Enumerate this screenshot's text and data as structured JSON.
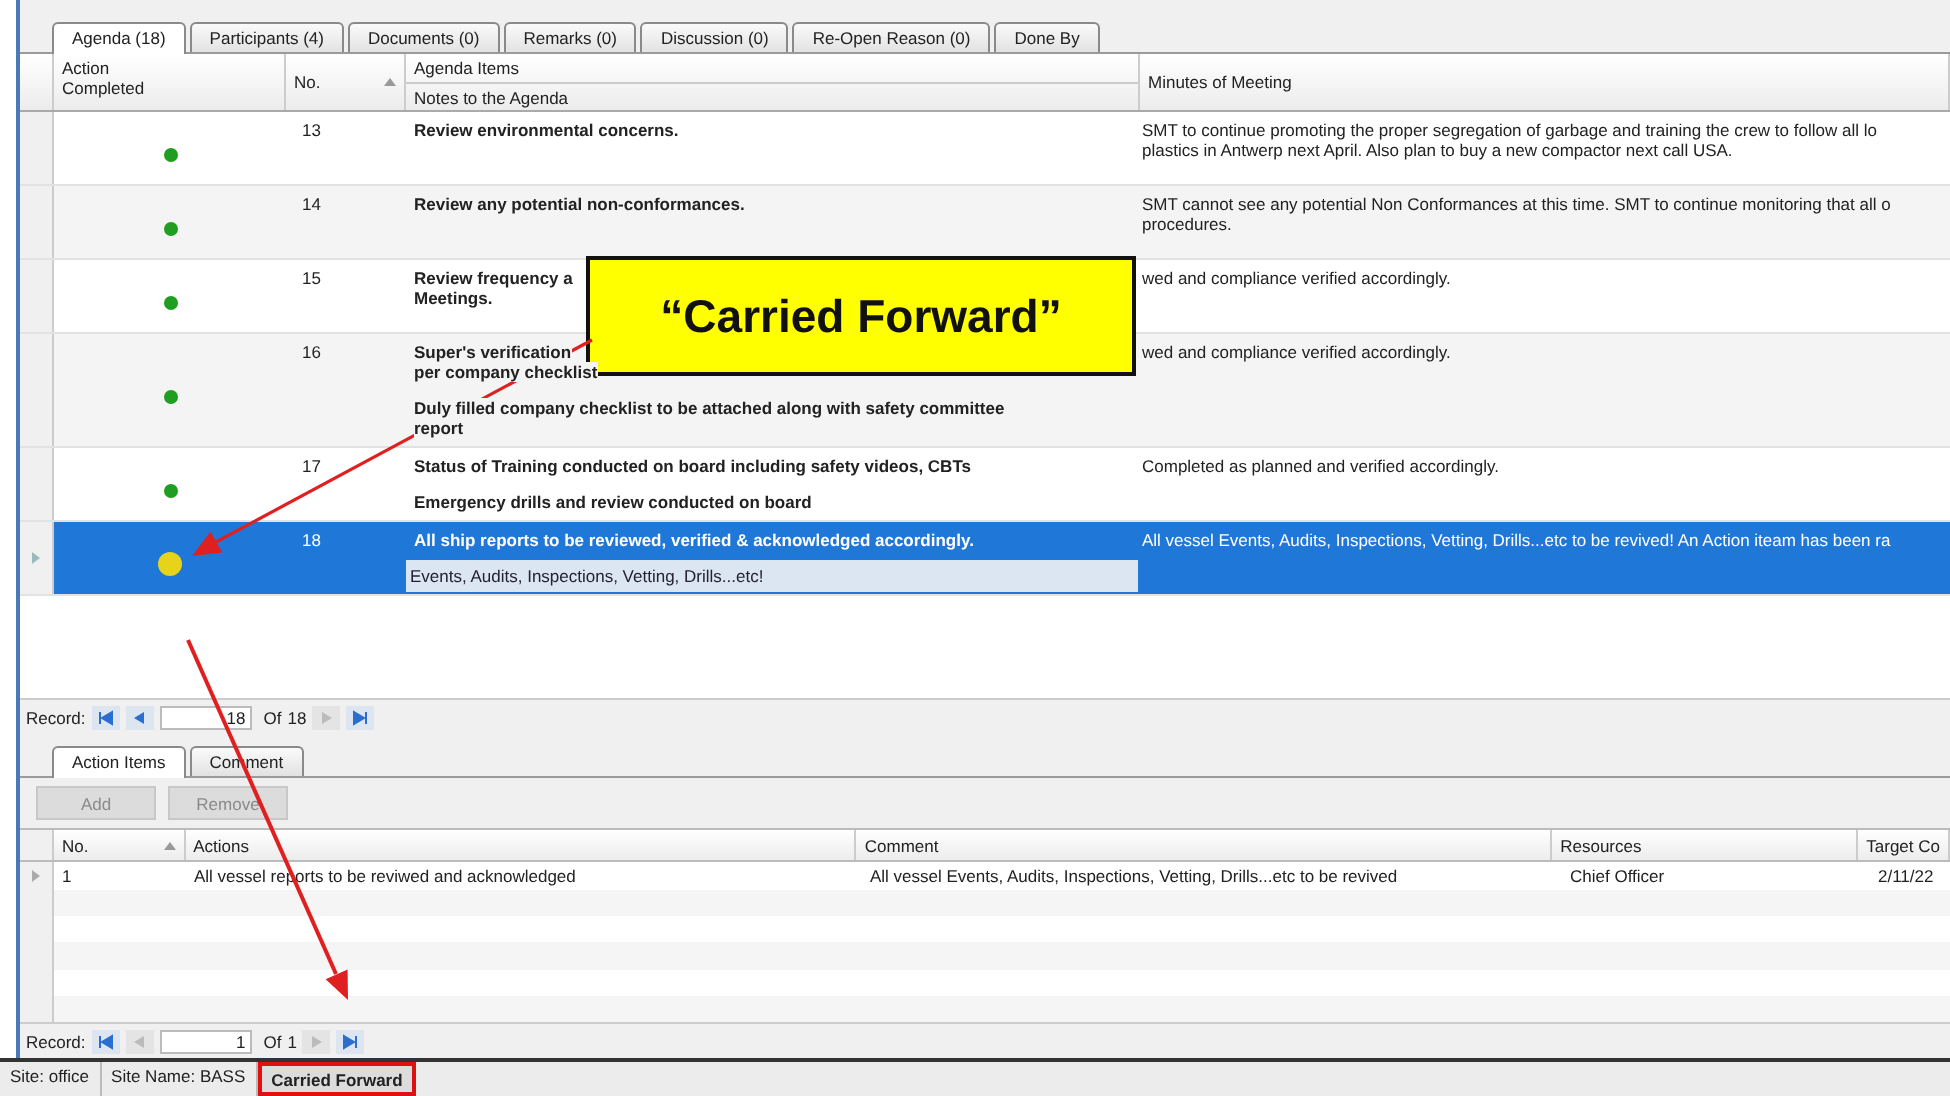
{
  "tabs": [
    {
      "label": "Agenda (18)",
      "selected": true
    },
    {
      "label": "Participants (4)",
      "selected": false
    },
    {
      "label": "Documents (0)",
      "selected": false
    },
    {
      "label": "Remarks (0)",
      "selected": false
    },
    {
      "label": "Discussion (0)",
      "selected": false
    },
    {
      "label": "Re-Open Reason (0)",
      "selected": false
    },
    {
      "label": "Done By",
      "selected": false
    }
  ],
  "agenda_table": {
    "columns": {
      "action": [
        "Action",
        "Completed"
      ],
      "no": "No.",
      "agenda_items": "Agenda Items",
      "notes": "Notes to the Agenda",
      "minutes": "Minutes of Meeting"
    },
    "rows": [
      {
        "no": "13",
        "color": "#1f9e1f",
        "selected": false,
        "items": [
          [
            "Review environmental concerns."
          ]
        ],
        "note": "",
        "minutes": [
          "SMT to continue promoting the proper segregation of garbage and training the crew to follow all lo",
          "plastics in Antwerp next April. Also plan to buy a new compactor next call USA."
        ]
      },
      {
        "no": "14",
        "color": "#1f9e1f",
        "selected": false,
        "items": [
          [
            "Review any potential non-conformances."
          ]
        ],
        "note": "",
        "minutes": [
          "SMT cannot see any potential Non Conformances at this time. SMT to continue monitoring that all o",
          "procedures."
        ]
      },
      {
        "no": "15",
        "color": "#1f9e1f",
        "selected": false,
        "items": [
          [
            "Review frequency a",
            "Meetings."
          ]
        ],
        "note": "",
        "minutes": [
          "wed and compliance verified accordingly."
        ]
      },
      {
        "no": "16",
        "color": "#1f9e1f",
        "selected": false,
        "items": [
          [
            "Super's verification",
            "per company checklist"
          ],
          [
            "Duly filled company checklist to be attached along with safety committee",
            "report"
          ]
        ],
        "note": "",
        "minutes": [
          "wed and compliance verified accordingly."
        ]
      },
      {
        "no": "17",
        "color": "#1f9e1f",
        "selected": false,
        "items": [
          [
            "Status of Training conducted on board including safety videos, CBTs"
          ],
          [
            "Emergency drills and review conducted on board"
          ]
        ],
        "note": "",
        "minutes": [
          "Completed as planned and verified accordingly."
        ]
      },
      {
        "no": "18",
        "color": "#e6d31a",
        "selected": true,
        "items": [
          [
            "All ship reports to be reviewed, verified & acknowledged accordingly."
          ]
        ],
        "note": "Events, Audits, Inspections, Vetting, Drills...etc!",
        "minutes": [
          "All vessel Events, Audits, Inspections, Vetting, Drills...etc to be revived! An Action iteam has been ra"
        ]
      }
    ]
  },
  "agenda_nav": {
    "label": "Record:",
    "value": "18",
    "of": "Of",
    "total": "18"
  },
  "sub_tabs": [
    {
      "label": "Action Items",
      "selected": true
    },
    {
      "label": "Comment",
      "selected": false
    }
  ],
  "toolbar": [
    {
      "label": "Add",
      "disabled": true
    },
    {
      "label": "Remove",
      "disabled": true
    }
  ],
  "actions_table": {
    "columns": [
      "No.",
      "Actions",
      "Comment",
      "Resources",
      "Target Co"
    ],
    "rows": [
      {
        "cells": [
          "1",
          "All vessel reports to be reviwed and acknowledged",
          "All vessel Events, Audits, Inspections, Vetting, Drills...etc to be revived",
          "Chief Officer",
          "2/11/22"
        ]
      }
    ]
  },
  "actions_nav": {
    "label": "Record:",
    "value": "1",
    "of": "Of",
    "total": "1"
  },
  "status_bar": [
    {
      "text": "Site: office",
      "highlighted": false
    },
    {
      "text": "Site Name: BASS",
      "highlighted": false
    },
    {
      "text": "Carried Forward",
      "highlighted": true
    }
  ],
  "callout": {
    "text": "“Carried Forward”"
  }
}
